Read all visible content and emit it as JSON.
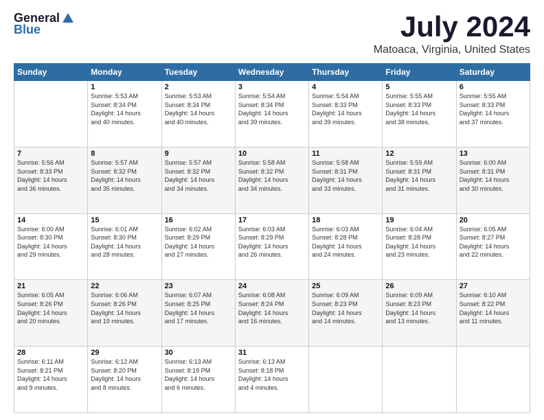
{
  "logo": {
    "general": "General",
    "blue": "Blue"
  },
  "header": {
    "title": "July 2024",
    "subtitle": "Matoaca, Virginia, United States"
  },
  "days_of_week": [
    "Sunday",
    "Monday",
    "Tuesday",
    "Wednesday",
    "Thursday",
    "Friday",
    "Saturday"
  ],
  "weeks": [
    [
      {
        "day": "",
        "info": ""
      },
      {
        "day": "1",
        "info": "Sunrise: 5:53 AM\nSunset: 8:34 PM\nDaylight: 14 hours\nand 40 minutes."
      },
      {
        "day": "2",
        "info": "Sunrise: 5:53 AM\nSunset: 8:34 PM\nDaylight: 14 hours\nand 40 minutes."
      },
      {
        "day": "3",
        "info": "Sunrise: 5:54 AM\nSunset: 8:34 PM\nDaylight: 14 hours\nand 39 minutes."
      },
      {
        "day": "4",
        "info": "Sunrise: 5:54 AM\nSunset: 8:33 PM\nDaylight: 14 hours\nand 39 minutes."
      },
      {
        "day": "5",
        "info": "Sunrise: 5:55 AM\nSunset: 8:33 PM\nDaylight: 14 hours\nand 38 minutes."
      },
      {
        "day": "6",
        "info": "Sunrise: 5:55 AM\nSunset: 8:33 PM\nDaylight: 14 hours\nand 37 minutes."
      }
    ],
    [
      {
        "day": "7",
        "info": "Sunrise: 5:56 AM\nSunset: 8:33 PM\nDaylight: 14 hours\nand 36 minutes."
      },
      {
        "day": "8",
        "info": "Sunrise: 5:57 AM\nSunset: 8:32 PM\nDaylight: 14 hours\nand 35 minutes."
      },
      {
        "day": "9",
        "info": "Sunrise: 5:57 AM\nSunset: 8:32 PM\nDaylight: 14 hours\nand 34 minutes."
      },
      {
        "day": "10",
        "info": "Sunrise: 5:58 AM\nSunset: 8:32 PM\nDaylight: 14 hours\nand 34 minutes."
      },
      {
        "day": "11",
        "info": "Sunrise: 5:58 AM\nSunset: 8:31 PM\nDaylight: 14 hours\nand 33 minutes."
      },
      {
        "day": "12",
        "info": "Sunrise: 5:59 AM\nSunset: 8:31 PM\nDaylight: 14 hours\nand 31 minutes."
      },
      {
        "day": "13",
        "info": "Sunrise: 6:00 AM\nSunset: 8:31 PM\nDaylight: 14 hours\nand 30 minutes."
      }
    ],
    [
      {
        "day": "14",
        "info": "Sunrise: 6:00 AM\nSunset: 8:30 PM\nDaylight: 14 hours\nand 29 minutes."
      },
      {
        "day": "15",
        "info": "Sunrise: 6:01 AM\nSunset: 8:30 PM\nDaylight: 14 hours\nand 28 minutes."
      },
      {
        "day": "16",
        "info": "Sunrise: 6:02 AM\nSunset: 8:29 PM\nDaylight: 14 hours\nand 27 minutes."
      },
      {
        "day": "17",
        "info": "Sunrise: 6:03 AM\nSunset: 8:29 PM\nDaylight: 14 hours\nand 26 minutes."
      },
      {
        "day": "18",
        "info": "Sunrise: 6:03 AM\nSunset: 8:28 PM\nDaylight: 14 hours\nand 24 minutes."
      },
      {
        "day": "19",
        "info": "Sunrise: 6:04 AM\nSunset: 8:28 PM\nDaylight: 14 hours\nand 23 minutes."
      },
      {
        "day": "20",
        "info": "Sunrise: 6:05 AM\nSunset: 8:27 PM\nDaylight: 14 hours\nand 22 minutes."
      }
    ],
    [
      {
        "day": "21",
        "info": "Sunrise: 6:05 AM\nSunset: 8:26 PM\nDaylight: 14 hours\nand 20 minutes."
      },
      {
        "day": "22",
        "info": "Sunrise: 6:06 AM\nSunset: 8:26 PM\nDaylight: 14 hours\nand 19 minutes."
      },
      {
        "day": "23",
        "info": "Sunrise: 6:07 AM\nSunset: 8:25 PM\nDaylight: 14 hours\nand 17 minutes."
      },
      {
        "day": "24",
        "info": "Sunrise: 6:08 AM\nSunset: 8:24 PM\nDaylight: 14 hours\nand 16 minutes."
      },
      {
        "day": "25",
        "info": "Sunrise: 6:09 AM\nSunset: 8:23 PM\nDaylight: 14 hours\nand 14 minutes."
      },
      {
        "day": "26",
        "info": "Sunrise: 6:09 AM\nSunset: 8:23 PM\nDaylight: 14 hours\nand 13 minutes."
      },
      {
        "day": "27",
        "info": "Sunrise: 6:10 AM\nSunset: 8:22 PM\nDaylight: 14 hours\nand 11 minutes."
      }
    ],
    [
      {
        "day": "28",
        "info": "Sunrise: 6:11 AM\nSunset: 8:21 PM\nDaylight: 14 hours\nand 9 minutes."
      },
      {
        "day": "29",
        "info": "Sunrise: 6:12 AM\nSunset: 8:20 PM\nDaylight: 14 hours\nand 8 minutes."
      },
      {
        "day": "30",
        "info": "Sunrise: 6:13 AM\nSunset: 8:19 PM\nDaylight: 14 hours\nand 6 minutes."
      },
      {
        "day": "31",
        "info": "Sunrise: 6:13 AM\nSunset: 8:18 PM\nDaylight: 14 hours\nand 4 minutes."
      },
      {
        "day": "",
        "info": ""
      },
      {
        "day": "",
        "info": ""
      },
      {
        "day": "",
        "info": ""
      }
    ]
  ],
  "accent_color": "#2e6da4"
}
